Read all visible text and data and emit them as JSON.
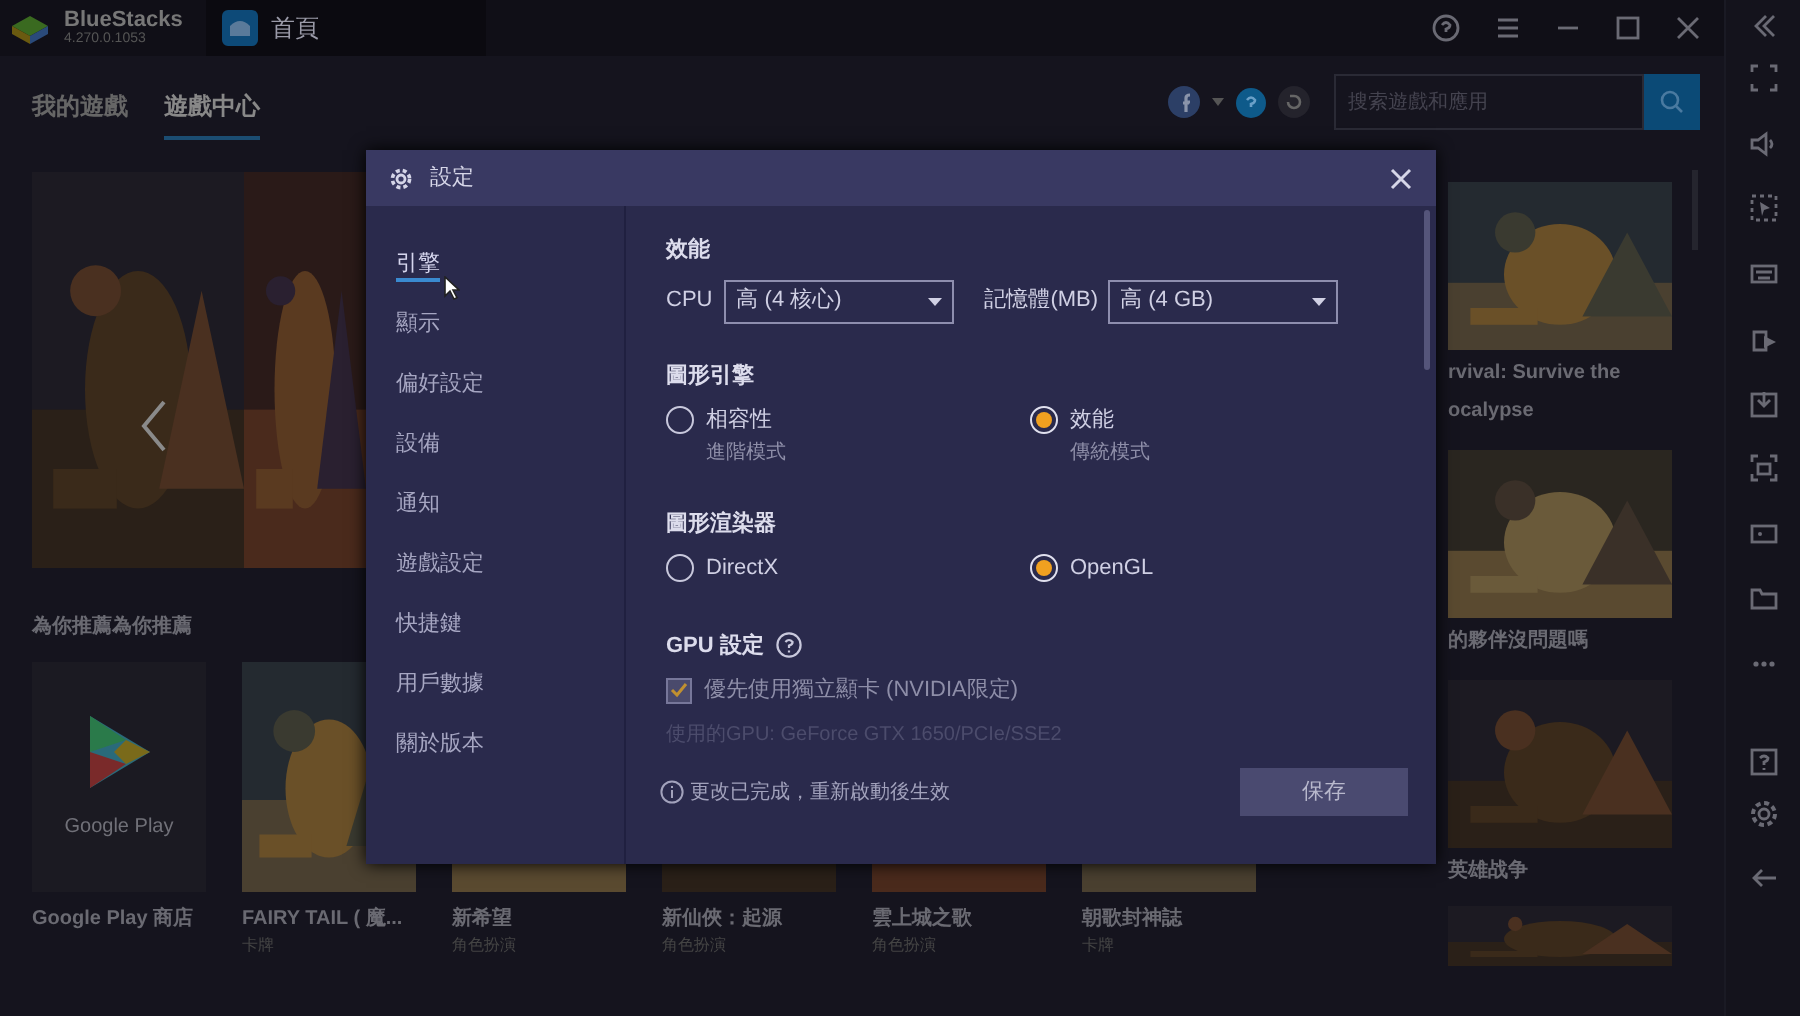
{
  "app": {
    "name": "BlueStacks",
    "version": "4.270.0.1053"
  },
  "window_tabs": [
    {
      "label": "首頁",
      "selected": true
    }
  ],
  "nav_tabs": [
    {
      "label": "我的遊戲",
      "selected": false
    },
    {
      "label": "遊戲中心",
      "selected": true
    }
  ],
  "search": {
    "placeholder": "搜索遊戲和應用"
  },
  "recommended": {
    "title": "為你推薦為你推薦",
    "cards": [
      {
        "kind": "store",
        "logo_text": "Google Play",
        "title": "Google Play 商店"
      },
      {
        "kind": "game",
        "title": "FAIRY TAIL ( 魔...",
        "genre": "卡牌"
      },
      {
        "kind": "game",
        "title": "新希望",
        "genre": "角色扮演"
      },
      {
        "kind": "game",
        "title": "新仙俠：起源",
        "genre": "角色扮演"
      },
      {
        "kind": "game",
        "title": "雲上城之歌",
        "genre": "角色扮演"
      },
      {
        "kind": "game",
        "title": "朝歌封神誌",
        "genre": "卡牌"
      }
    ]
  },
  "side_cards": [
    {
      "title_lines": [
        "rvival: Survive the",
        "ocalypse"
      ]
    },
    {
      "title_lines": [
        "的夥伴沒問題嗎"
      ]
    },
    {
      "title_lines": [
        "英雄战争"
      ]
    }
  ],
  "dialog": {
    "title": "設定",
    "menu": [
      {
        "label": "引擎",
        "selected": true
      },
      {
        "label": "顯示",
        "selected": false
      },
      {
        "label": "偏好設定",
        "selected": false
      },
      {
        "label": "設備",
        "selected": false
      },
      {
        "label": "通知",
        "selected": false
      },
      {
        "label": "遊戲設定",
        "selected": false
      },
      {
        "label": "快捷鍵",
        "selected": false
      },
      {
        "label": "用戶數據",
        "selected": false
      },
      {
        "label": "關於版本",
        "selected": false
      }
    ],
    "performance": {
      "heading": "效能",
      "cpu_label": "CPU",
      "cpu_value": "高 (4 核心)",
      "memory_label": "記憶體(MB)",
      "memory_value": "高 (4 GB)"
    },
    "graphics_engine": {
      "heading": "圖形引擎",
      "options": [
        {
          "label": "相容性",
          "sublabel": "進階模式",
          "selected": false
        },
        {
          "label": "效能",
          "sublabel": "傳統模式",
          "selected": true
        }
      ]
    },
    "renderer": {
      "heading": "圖形渲染器",
      "options": [
        {
          "label": "DirectX",
          "selected": false
        },
        {
          "label": "OpenGL",
          "selected": true
        }
      ]
    },
    "gpu": {
      "heading": "GPU 設定",
      "prefer_dedicated": {
        "label": "優先使用獨立顯卡 (NVIDIA限定)",
        "checked": true
      },
      "gpu_in_use": "使用的GPU: GeForce GTX 1650/PCIe/SSE2"
    },
    "footer": {
      "notice": "更改已完成，重新啟動後生效",
      "save": "保存"
    }
  }
}
